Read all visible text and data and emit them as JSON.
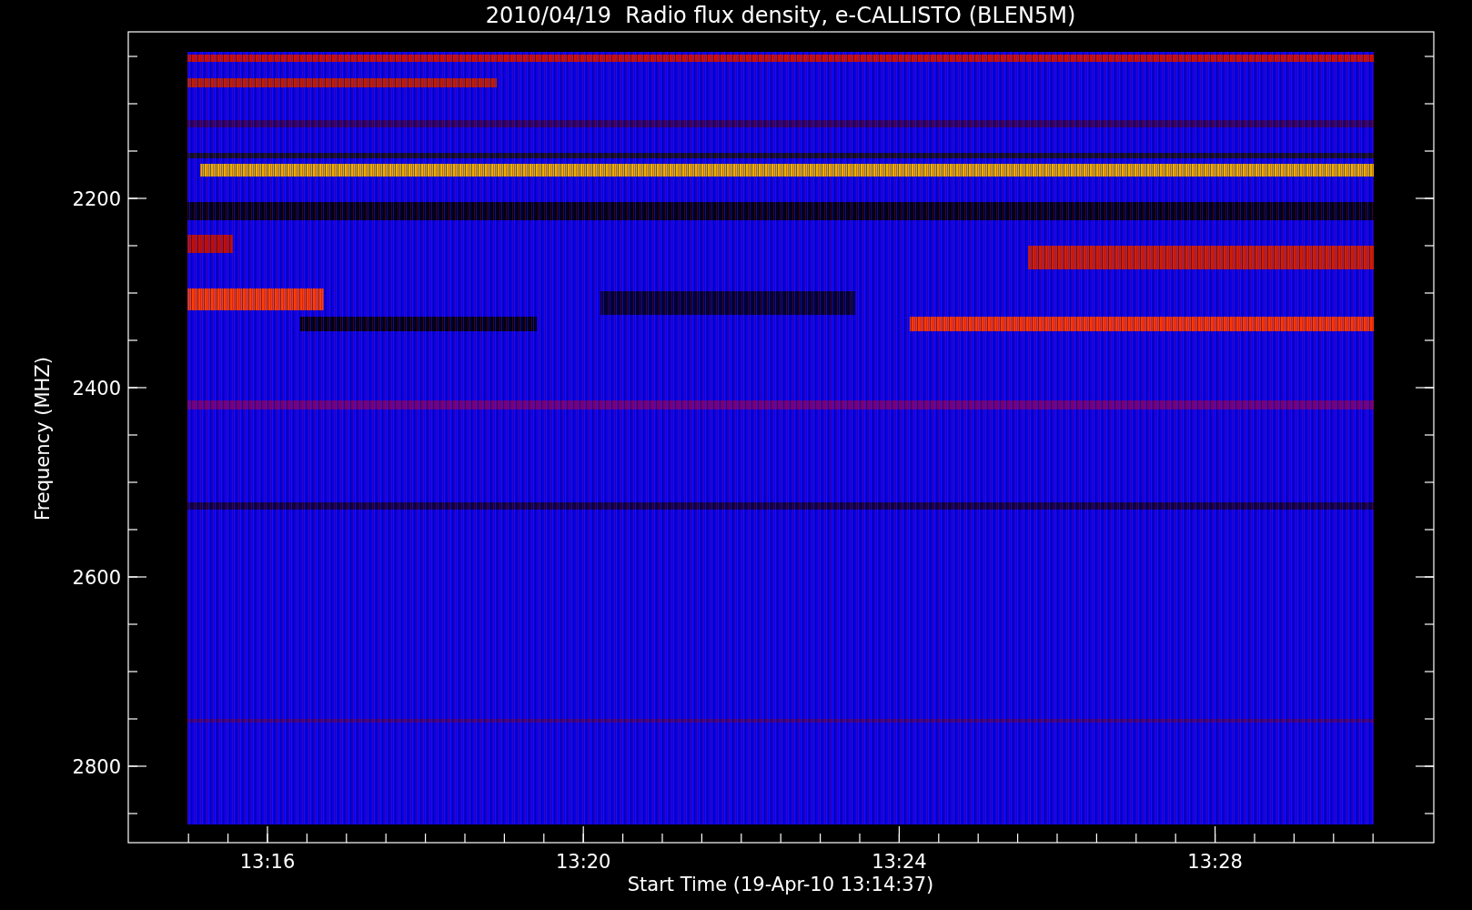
{
  "chart": {
    "title": "2010/04/19  Radio flux density, e-CALLISTO (BLEN5M)",
    "y_axis": {
      "label": "Frequency (MHZ)",
      "ticks": [
        "2200",
        "2400",
        "2600",
        "2800"
      ]
    },
    "x_axis": {
      "label": "Start Time (19-Apr-10 13:14:37)",
      "ticks": [
        "13:16",
        "13:20",
        "13:24",
        "13:28"
      ]
    }
  }
}
